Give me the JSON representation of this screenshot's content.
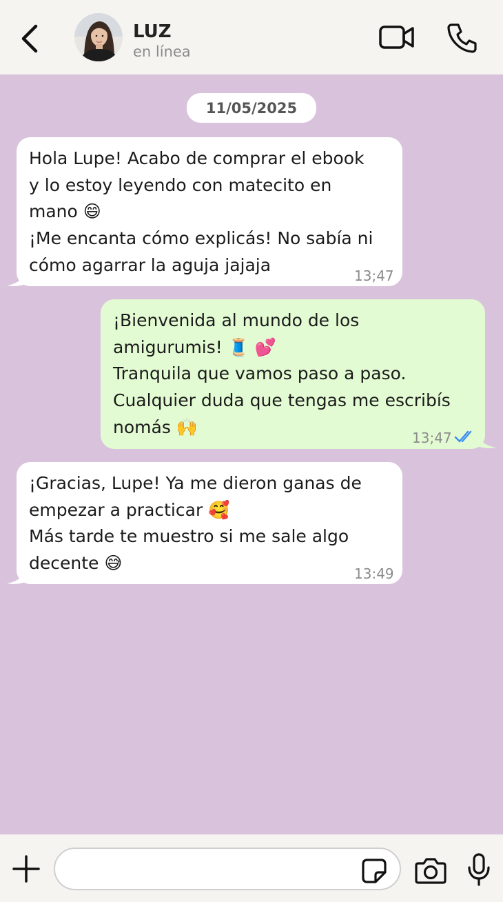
{
  "header": {
    "contact_name": "LUZ",
    "status": "en línea"
  },
  "chat": {
    "date": "11/05/2025",
    "messages": [
      {
        "direction": "incoming",
        "text": "Hola Lupe! Acabo de comprar el ebook\ny lo estoy leyendo con matecito en\nmano 😄\n¡Me encanta cómo explicás! No sabía ni\ncómo agarrar la aguja jajaja",
        "time": "13;47"
      },
      {
        "direction": "outgoing",
        "text": "¡Bienvenida al mundo de los\namigurumis! 🧵 💕\nTranquila que vamos paso a paso.\nCualquier duda que tengas me escribís\nnomás 🙌",
        "time": "13;47",
        "status": "read"
      },
      {
        "direction": "incoming",
        "text": "¡Gracias, Lupe! Ya me dieron ganas de\nempezar a practicar 🥰\nMás tarde te muestro si me sale algo\ndecente 😅",
        "time": "13:49"
      }
    ]
  },
  "composer": {
    "input_value": "",
    "placeholder": ""
  },
  "colors": {
    "chat_background": "#d9c3dc",
    "header_background": "#f5f4f0",
    "incoming_bubble": "#ffffff",
    "outgoing_bubble": "#e3fbd3",
    "read_ticks": "#3b8df0"
  },
  "icons": {
    "back": "chevron-left-icon",
    "video": "video-camera-icon",
    "call": "phone-icon",
    "add": "plus-icon",
    "sticker": "sticker-icon",
    "camera": "camera-icon",
    "mic": "microphone-icon"
  }
}
